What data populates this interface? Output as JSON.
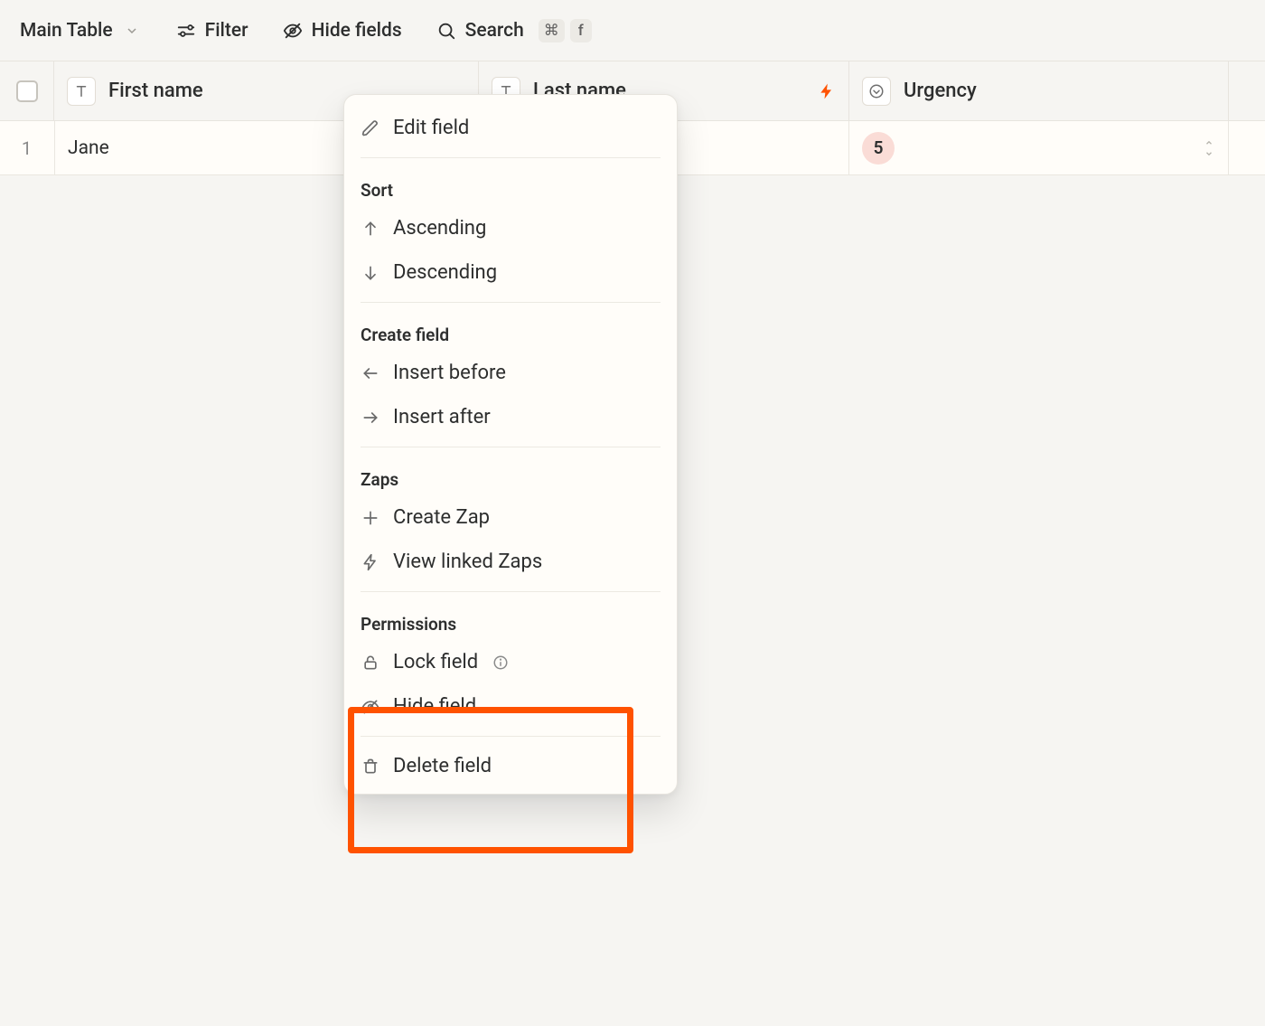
{
  "toolbar": {
    "view_name": "Main Table",
    "filter_label": "Filter",
    "hide_fields_label": "Hide fields",
    "search_label": "Search",
    "search_kbd_cmd": "⌘",
    "search_kbd_key": "f"
  },
  "columns": {
    "first_name": "First name",
    "last_name": "Last name",
    "urgency": "Urgency"
  },
  "rows": [
    {
      "index": "1",
      "first_name": "Jane",
      "last_name": "",
      "urgency": "5"
    }
  ],
  "context_menu": {
    "edit_field": "Edit field",
    "sort_heading": "Sort",
    "ascending": "Ascending",
    "descending": "Descending",
    "create_field_heading": "Create field",
    "insert_before": "Insert before",
    "insert_after": "Insert after",
    "zaps_heading": "Zaps",
    "create_zap": "Create Zap",
    "view_linked_zaps": "View linked Zaps",
    "permissions_heading": "Permissions",
    "lock_field": "Lock field",
    "hide_field": "Hide field",
    "delete_field": "Delete field"
  }
}
